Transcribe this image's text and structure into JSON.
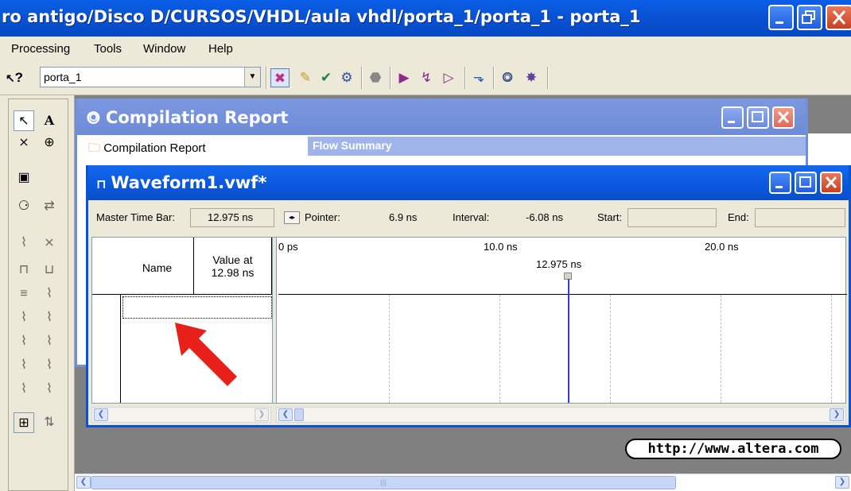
{
  "app": {
    "title": "ro antigo/Disco D/CURSOS/VHDL/aula vhdl/porta_1/porta_1 - porta_1",
    "url": "http://www.altera.com"
  },
  "menu": [
    "Processing",
    "Tools",
    "Window",
    "Help"
  ],
  "toolbar": {
    "help_icon": "?",
    "project": "porta_1"
  },
  "compilation_report": {
    "title": "Compilation Report",
    "tree_root": "Compilation Report",
    "flow_summary": "Flow Summary"
  },
  "waveform": {
    "title": "Waveform1.vwf*",
    "master_time_bar_label": "Master Time Bar:",
    "master_time_bar_value": "12.975 ns",
    "pointer_label": "Pointer:",
    "pointer_value": "6.9 ns",
    "interval_label": "Interval:",
    "interval_value": "-6.08 ns",
    "start_label": "Start:",
    "start_value": "",
    "end_label": "End:",
    "end_value": "",
    "col_name": "Name",
    "col_value_line1": "Value at",
    "col_value_line2": "12.98 ns",
    "ticks": [
      "0 ps",
      "10.0 ns",
      "20.0 ns"
    ],
    "marker_label": "12.975 ns"
  },
  "colors": {
    "titlebar": "#0853d3",
    "inactive_title": "#7b98e0",
    "annotation_arrow": "#e8201a",
    "time_bar": "#3a3ad6"
  }
}
